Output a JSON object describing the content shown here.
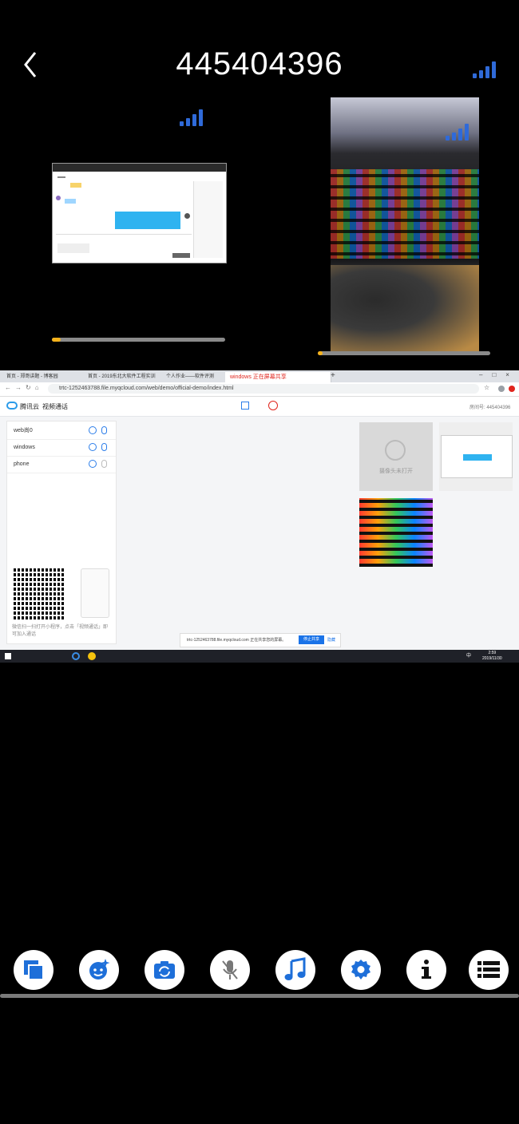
{
  "header": {
    "room_id": "445404396"
  },
  "tiles": {
    "screen_share": {
      "progress": 0.05
    },
    "camera": {
      "progress": 0.03
    }
  },
  "desktop": {
    "tabs": [
      "首页 - 郑哥讲题 - 博客园",
      "首页 - 2019东北大软件工程实训",
      "个人作业——软件评测"
    ],
    "share_notice": "windows 正在屏幕共享",
    "url": "trtc-1252463788.file.myqcloud.com/web/demo/official-demo/index.html",
    "brand": "腾讯云",
    "app_name": "视频通话",
    "room_label": "房间号: 445404396",
    "users": [
      "web尚0",
      "windows",
      "phone"
    ],
    "camera_off_text": "摄像头未打开",
    "qr_hint": "微信扫一扫打开小程序，点击「视频通话」即可加入通话",
    "share_bar_text": "trtc-1252463788.file.myqcloud.com 正在共享您的屏幕。",
    "stop_share": "停止共享",
    "hide": "隐藏",
    "clock_time": "2:59",
    "clock_date": "2019/11/30",
    "ime": "中"
  },
  "controls": [
    {
      "name": "switch-layout-icon"
    },
    {
      "name": "beauty-icon"
    },
    {
      "name": "switch-camera-icon"
    },
    {
      "name": "mic-off-icon"
    },
    {
      "name": "music-icon"
    },
    {
      "name": "settings-icon"
    },
    {
      "name": "info-icon"
    },
    {
      "name": "member-list-icon"
    }
  ],
  "colors": {
    "accent": "#2f6ad9",
    "progress": "#f5b21b"
  }
}
